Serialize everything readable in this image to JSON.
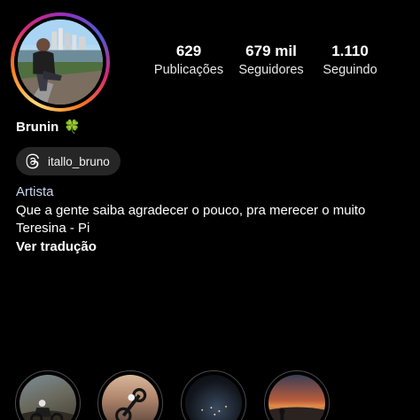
{
  "profile": {
    "name": "Brunin",
    "name_emoji": "🍀",
    "threads_handle": "itallo_bruno"
  },
  "stats": {
    "posts": {
      "value": "629",
      "label": "Publicações"
    },
    "followers": {
      "value": "679 mil",
      "label": "Seguidores"
    },
    "following": {
      "value": "1.110",
      "label": "Seguindo"
    }
  },
  "bio": {
    "category": "Artista",
    "line1": "Que a gente saiba agradecer o pouco, pra merecer o muito",
    "line2": "Teresina - Pi",
    "translate_link": "Ver tradução"
  },
  "colors": {
    "background": "#000000",
    "pill": "#262626",
    "category_text": "#c7d6ee"
  },
  "icons": {
    "threads": "threads-icon",
    "clover": "four-leaf-clover"
  }
}
